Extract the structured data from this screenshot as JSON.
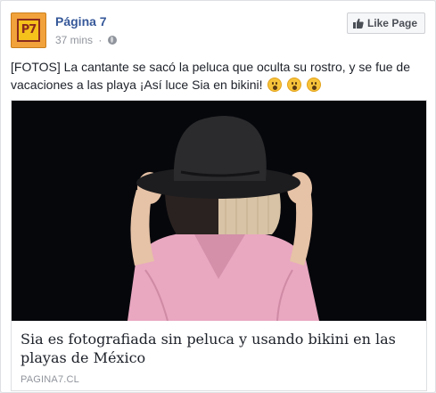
{
  "post": {
    "page_name": "Página 7",
    "avatar_text": "P7",
    "time": "37 mins",
    "separator": "·",
    "like_button_label": "Like Page",
    "caption": "[FOTOS] La cantante se sacó la peluca que oculta su rostro, y se fue de vacaciones a las playa ¡Así luce Sia en bikini!",
    "emoji_count": 3,
    "emoji_icon": "astonished-face-icon",
    "globe_icon": "globe-icon",
    "like_icon": "thumbs-up-icon"
  },
  "link": {
    "title": "Sia es fotografiada sin peluca y usando bikini en las playas de México",
    "domain": "PAGINA7.CL"
  },
  "colors": {
    "link_blue": "#365899",
    "meta_gray": "#90949c",
    "image_bg": "#06070b",
    "hat": "#1d1d1f",
    "wig": "#d8c3a6",
    "jacket": "#e9a7c0"
  }
}
